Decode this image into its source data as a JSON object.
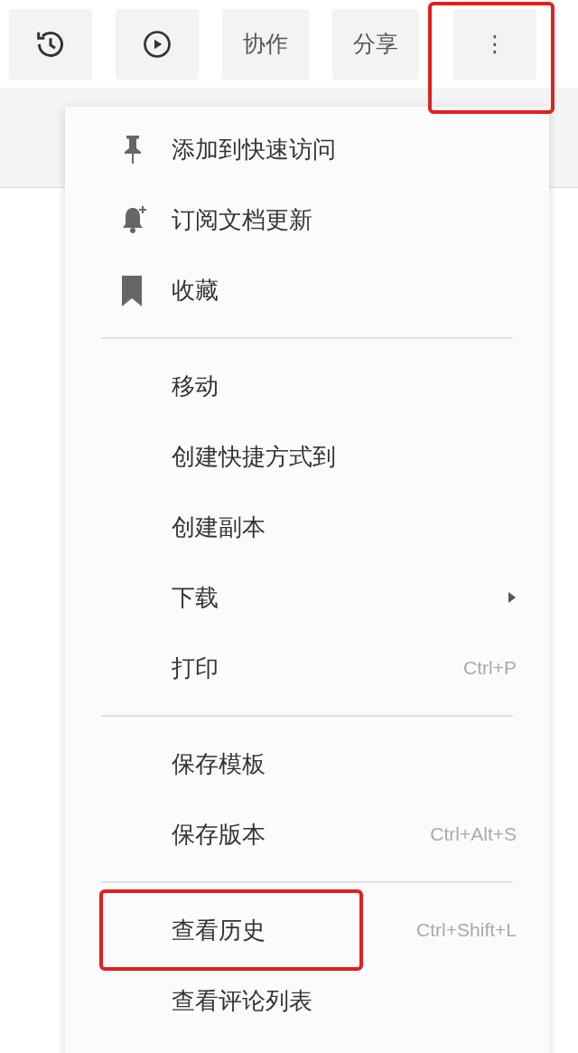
{
  "toolbar": {
    "buttons": [
      {
        "kind": "icon",
        "highlighted": false
      },
      {
        "kind": "icon",
        "highlighted": false
      },
      {
        "kind": "text",
        "label": "协作",
        "highlighted": false
      },
      {
        "kind": "text",
        "label": "分享",
        "highlighted": false
      },
      {
        "kind": "more",
        "label": "⋮",
        "highlighted": true
      }
    ]
  },
  "menu": {
    "groups": [
      {
        "items": [
          {
            "label": "添加到快速访问",
            "highlighted": false
          },
          {
            "label": "订阅文档更新",
            "highlighted": false
          },
          {
            "label": "收藏",
            "highlighted": false
          }
        ]
      },
      {
        "items": [
          {
            "label": "移动",
            "highlighted": false
          },
          {
            "label": "创建快捷方式到",
            "highlighted": false
          },
          {
            "label": "创建副本",
            "highlighted": false
          },
          {
            "label": "下载",
            "submenu": true,
            "highlighted": false
          },
          {
            "label": "打印",
            "shortcut": "Ctrl+P",
            "highlighted": false
          }
        ]
      },
      {
        "items": [
          {
            "label": "保存模板",
            "highlighted": false
          },
          {
            "label": "保存版本",
            "shortcut": "Ctrl+Alt+S",
            "highlighted": false
          }
        ]
      },
      {
        "items": [
          {
            "label": "查看历史",
            "shortcut": "Ctrl+Shift+L",
            "highlighted": true
          },
          {
            "label": "查看评论列表",
            "highlighted": false
          }
        ]
      }
    ]
  }
}
